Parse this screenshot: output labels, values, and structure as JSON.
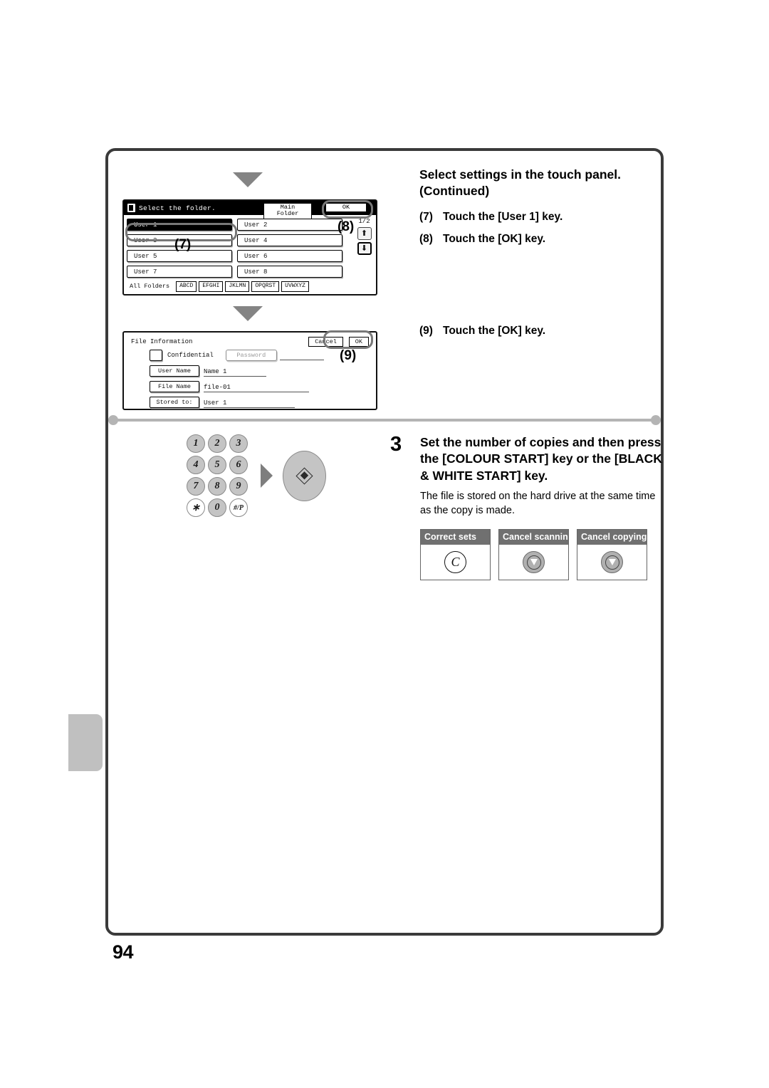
{
  "page": {
    "number": "94"
  },
  "right_column": {
    "heading": "Select settings in the touch panel. (Continued)",
    "steps": [
      {
        "num": "(7)",
        "text": "Touch the [User 1] key."
      },
      {
        "num": "(8)",
        "text": "Touch the [OK] key."
      }
    ],
    "step9": {
      "num": "(9)",
      "text": "Touch the [OK] key."
    }
  },
  "step3": {
    "number": "3",
    "title": "Set the number of copies and then press the [COLOUR START] key or the [BLACK & WHITE START] key.",
    "note": "The file is stored on the hard drive at the same time as the copy is made.",
    "key_boxes": [
      {
        "label": "Correct sets",
        "glyph": "C",
        "icon": "clear-icon"
      },
      {
        "label": "Cancel scanning",
        "glyph": "",
        "icon": "stop-icon"
      },
      {
        "label": "Cancel copying",
        "glyph": "",
        "icon": "stop-icon"
      }
    ]
  },
  "keypad": {
    "keys": [
      "1",
      "2",
      "3",
      "4",
      "5",
      "6",
      "7",
      "8",
      "9",
      "∗",
      "0",
      "#/P"
    ],
    "start_key_icon": "start-diamond-icon"
  },
  "folder_panel": {
    "header": {
      "icon": "document-folder-icon",
      "title": "Select the folder.",
      "main_folder_button": "Main Folder",
      "ok_button": "OK"
    },
    "folders": [
      "User 1",
      "User 2",
      "User 3",
      "User 4",
      "User 5",
      "User 6",
      "User 7",
      "User 8"
    ],
    "selected_folder": "User 1",
    "page_indicator": "1/2",
    "scroll_up_icon": "arrow-up-icon",
    "scroll_down_icon": "arrow-down-icon",
    "tabs": [
      "All Folders",
      "ABCD",
      "EFGHI",
      "JKLMN",
      "OPQRST",
      "UVWXYZ"
    ],
    "active_tab": "All Folders",
    "callouts": {
      "seven": "(7)",
      "eight": "(8)"
    }
  },
  "file_panel": {
    "title": "File Information",
    "cancel_button": "Cancel",
    "ok_button": "OK",
    "confidential_label": "Confidential",
    "password_button": "Password",
    "rows": [
      {
        "label": "User Name",
        "value": "Name 1"
      },
      {
        "label": "File Name",
        "value": "file-01"
      },
      {
        "label": "Stored to:",
        "value": "User 1"
      }
    ],
    "callout": "(9)"
  },
  "colors": {
    "frame": "#3a3a3a",
    "divider": "#b4b4b4",
    "arrow": "#848484",
    "ring": "#787878",
    "key_label_bg": "#707070",
    "side_tab": "#c0c0c0"
  }
}
